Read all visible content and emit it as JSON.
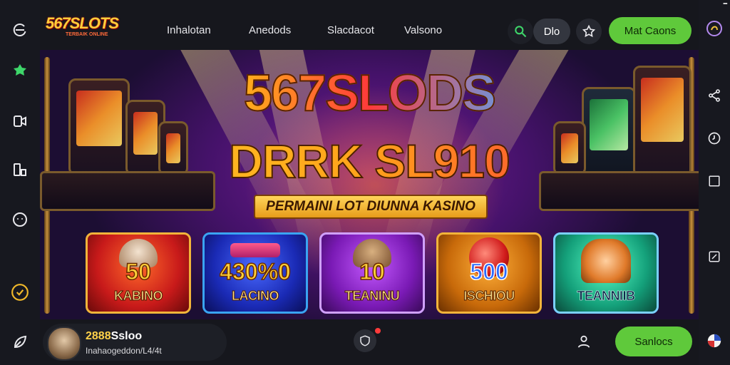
{
  "header": {
    "logo": "567SLOTS",
    "logo_sub": "TERBAIK ONLINE",
    "nav": [
      "Inhalotan",
      "Anedods",
      "Slacdacot",
      "Valsono"
    ],
    "pill_label": "Dlo",
    "cta_label": "Mat Caons"
  },
  "banner": {
    "headline_1": "567SLODS",
    "headline_2": "DRRK SL910",
    "tagline": "PERMAINI LOT DIUNNA KASINO",
    "cards": [
      {
        "number": "50",
        "label": "KABINO"
      },
      {
        "number": "430%0",
        "label": "LACINO"
      },
      {
        "number": "10",
        "label": "TEANINU"
      },
      {
        "number": "500",
        "label": "ISCHIOU"
      },
      {
        "number": "",
        "label": "TEANNIIB"
      }
    ]
  },
  "bottom": {
    "username_prefix": "2888",
    "username_suffix": "Ssloo",
    "status": "Inahaogeddon/L4/4t",
    "cta_label": "Sanlocs"
  },
  "colors": {
    "accent_green": "#5fc93b",
    "background": "#14151b",
    "gold": "#ffd13a"
  },
  "icons": {
    "left_sidebar": [
      "refresh-icon",
      "sparkle-icon",
      "camera-icon",
      "device-icon",
      "smile-icon",
      "clock-icon",
      "leaf-icon"
    ],
    "right_sidebar": [
      "profile-icon",
      "share-icon",
      "history-icon",
      "square-icon",
      "screen-icon",
      "flag-icon"
    ]
  }
}
